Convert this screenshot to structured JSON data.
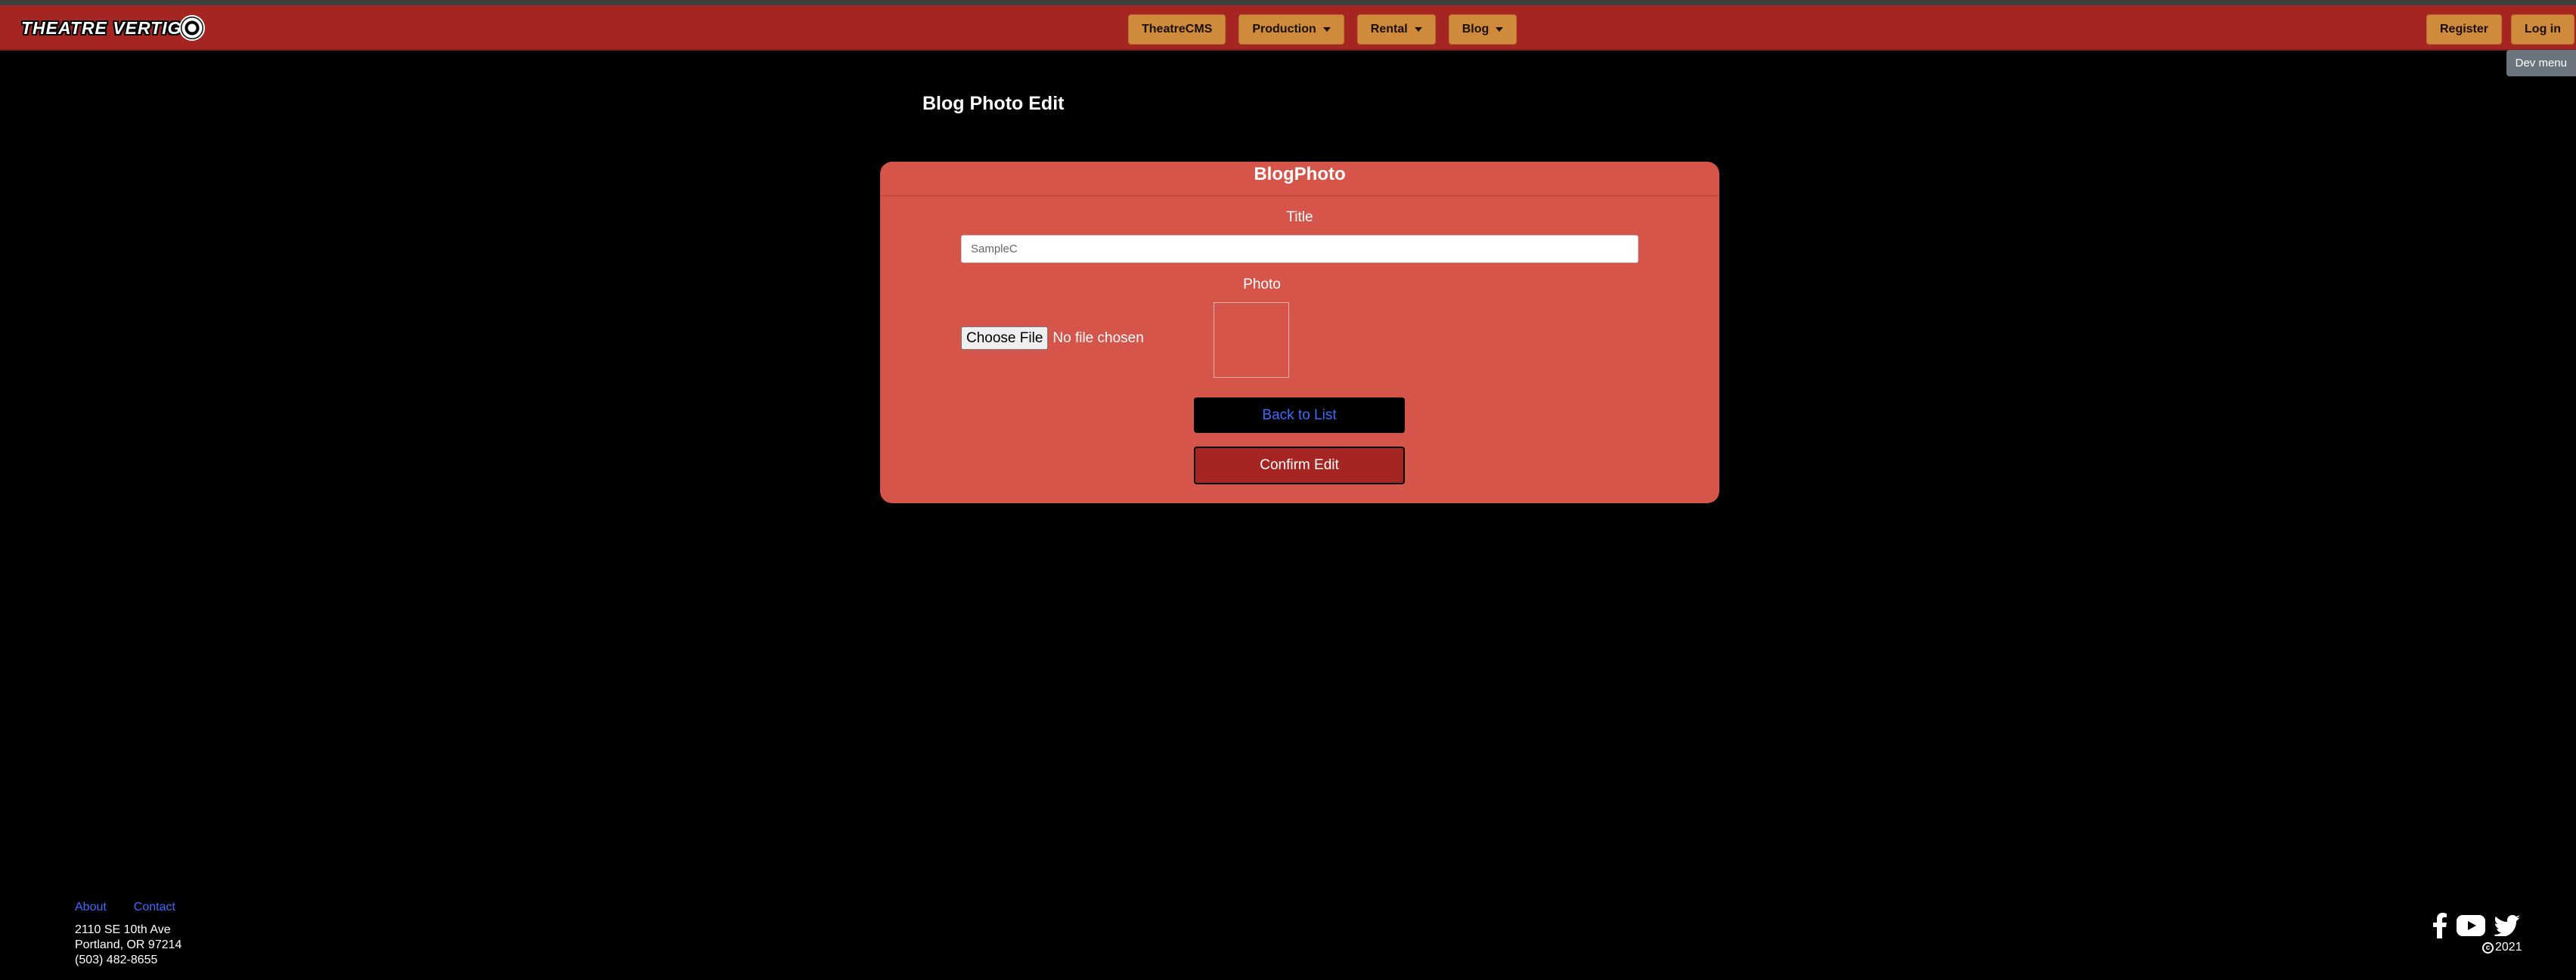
{
  "nav": {
    "logo_text": "THEATRE VERTIG",
    "items": [
      {
        "label": "TheatreCMS",
        "dropdown": false
      },
      {
        "label": "Production",
        "dropdown": true
      },
      {
        "label": "Rental",
        "dropdown": true
      },
      {
        "label": "Blog",
        "dropdown": true
      }
    ],
    "register_label": "Register",
    "login_label": "Log in",
    "dev_menu_label": "Dev menu"
  },
  "page": {
    "title": "Blog Photo Edit"
  },
  "form": {
    "header": "BlogPhoto",
    "title_label": "Title",
    "title_value": "SampleC",
    "photo_label": "Photo",
    "choose_file_label": "Choose File",
    "no_file_text": "No file chosen",
    "back_label": "Back to List",
    "confirm_label": "Confirm Edit"
  },
  "footer": {
    "about_label": "About",
    "contact_label": "Contact",
    "address_line1": "2110 SE 10th Ave",
    "address_line2": "Portland, OR 97214",
    "phone": "(503) 482-8655",
    "copyright_year": "2021",
    "social_icons": [
      "facebook-icon",
      "youtube-icon",
      "twitter-icon"
    ]
  },
  "colors": {
    "navbar": "#a52522",
    "nav_button": "#d08a3b",
    "card": "#d5554b",
    "link": "#3d6cff"
  }
}
